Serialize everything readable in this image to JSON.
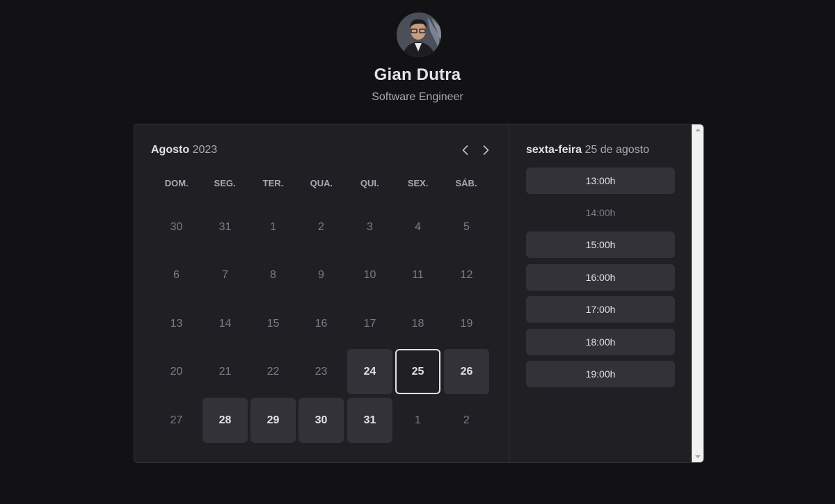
{
  "profile": {
    "name": "Gian Dutra",
    "role": "Software Engineer",
    "avatar_icon": "user-avatar"
  },
  "calendar": {
    "month": "Agosto",
    "year": "2023",
    "prev_icon": "chevron-left-icon",
    "next_icon": "chevron-right-icon",
    "weekdays": [
      "DOM.",
      "SEG.",
      "TER.",
      "QUA.",
      "QUI.",
      "SEX.",
      "SÁB."
    ],
    "weeks": [
      [
        {
          "label": "30",
          "state": "disabled"
        },
        {
          "label": "31",
          "state": "disabled"
        },
        {
          "label": "1",
          "state": "disabled"
        },
        {
          "label": "2",
          "state": "disabled"
        },
        {
          "label": "3",
          "state": "disabled"
        },
        {
          "label": "4",
          "state": "disabled"
        },
        {
          "label": "5",
          "state": "disabled"
        }
      ],
      [
        {
          "label": "6",
          "state": "disabled"
        },
        {
          "label": "7",
          "state": "disabled"
        },
        {
          "label": "8",
          "state": "disabled"
        },
        {
          "label": "9",
          "state": "disabled"
        },
        {
          "label": "10",
          "state": "disabled"
        },
        {
          "label": "11",
          "state": "disabled"
        },
        {
          "label": "12",
          "state": "disabled"
        }
      ],
      [
        {
          "label": "13",
          "state": "disabled"
        },
        {
          "label": "14",
          "state": "disabled"
        },
        {
          "label": "15",
          "state": "disabled"
        },
        {
          "label": "16",
          "state": "disabled"
        },
        {
          "label": "17",
          "state": "disabled"
        },
        {
          "label": "18",
          "state": "disabled"
        },
        {
          "label": "19",
          "state": "disabled"
        }
      ],
      [
        {
          "label": "20",
          "state": "disabled"
        },
        {
          "label": "21",
          "state": "disabled"
        },
        {
          "label": "22",
          "state": "disabled"
        },
        {
          "label": "23",
          "state": "disabled"
        },
        {
          "label": "24",
          "state": "available"
        },
        {
          "label": "25",
          "state": "selected"
        },
        {
          "label": "26",
          "state": "available"
        }
      ],
      [
        {
          "label": "27",
          "state": "disabled"
        },
        {
          "label": "28",
          "state": "available"
        },
        {
          "label": "29",
          "state": "available"
        },
        {
          "label": "30",
          "state": "available"
        },
        {
          "label": "31",
          "state": "available"
        },
        {
          "label": "1",
          "state": "disabled"
        },
        {
          "label": "2",
          "state": "disabled"
        }
      ]
    ]
  },
  "times": {
    "weekday": "sexta-feira",
    "date": "25 de agosto",
    "slots": [
      {
        "label": "13:00h",
        "available": true
      },
      {
        "label": "14:00h",
        "available": false
      },
      {
        "label": "15:00h",
        "available": true
      },
      {
        "label": "16:00h",
        "available": true
      },
      {
        "label": "17:00h",
        "available": true
      },
      {
        "label": "18:00h",
        "available": true
      },
      {
        "label": "19:00h",
        "available": true
      }
    ]
  },
  "colors": {
    "background": "#121214",
    "card": "#202024",
    "available_day": "#323238",
    "text": "#e1e1e6",
    "muted_text": "#7c7c8a"
  }
}
